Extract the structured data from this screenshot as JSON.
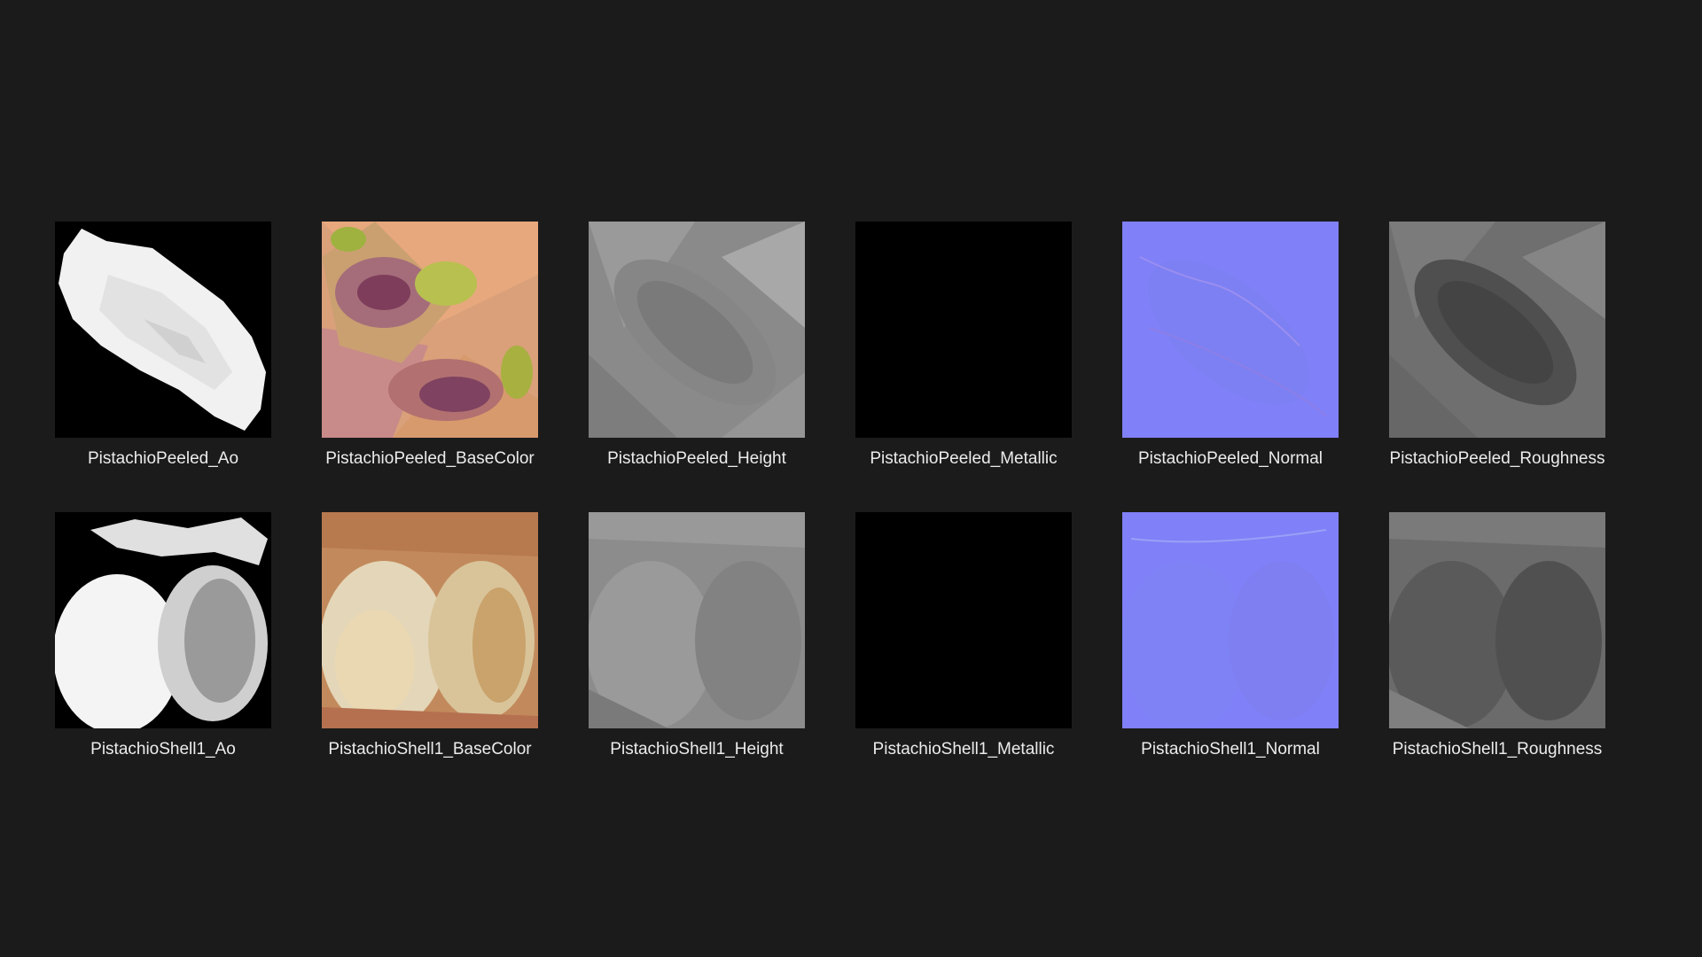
{
  "items": [
    {
      "name": "PistachioPeeled_Ao",
      "map": "ao-peeled"
    },
    {
      "name": "PistachioPeeled_BaseColor",
      "map": "basecolor-peeled"
    },
    {
      "name": "PistachioPeeled_Height",
      "map": "height-peeled"
    },
    {
      "name": "PistachioPeeled_Metallic",
      "map": "metallic"
    },
    {
      "name": "PistachioPeeled_Normal",
      "map": "normal-peeled"
    },
    {
      "name": "PistachioPeeled_Roughness",
      "map": "roughness-peeled"
    },
    {
      "name": "PistachioShell1_Ao",
      "map": "ao-shell"
    },
    {
      "name": "PistachioShell1_BaseColor",
      "map": "basecolor-shell"
    },
    {
      "name": "PistachioShell1_Height",
      "map": "height-shell"
    },
    {
      "name": "PistachioShell1_Metallic",
      "map": "metallic"
    },
    {
      "name": "PistachioShell1_Normal",
      "map": "normal-shell"
    },
    {
      "name": "PistachioShell1_Roughness",
      "map": "roughness-shell"
    }
  ],
  "colors": {
    "background": "#1b1b1b",
    "caption": "#ececec",
    "normal_blue": "#8080f8",
    "metallic": "#000000"
  }
}
